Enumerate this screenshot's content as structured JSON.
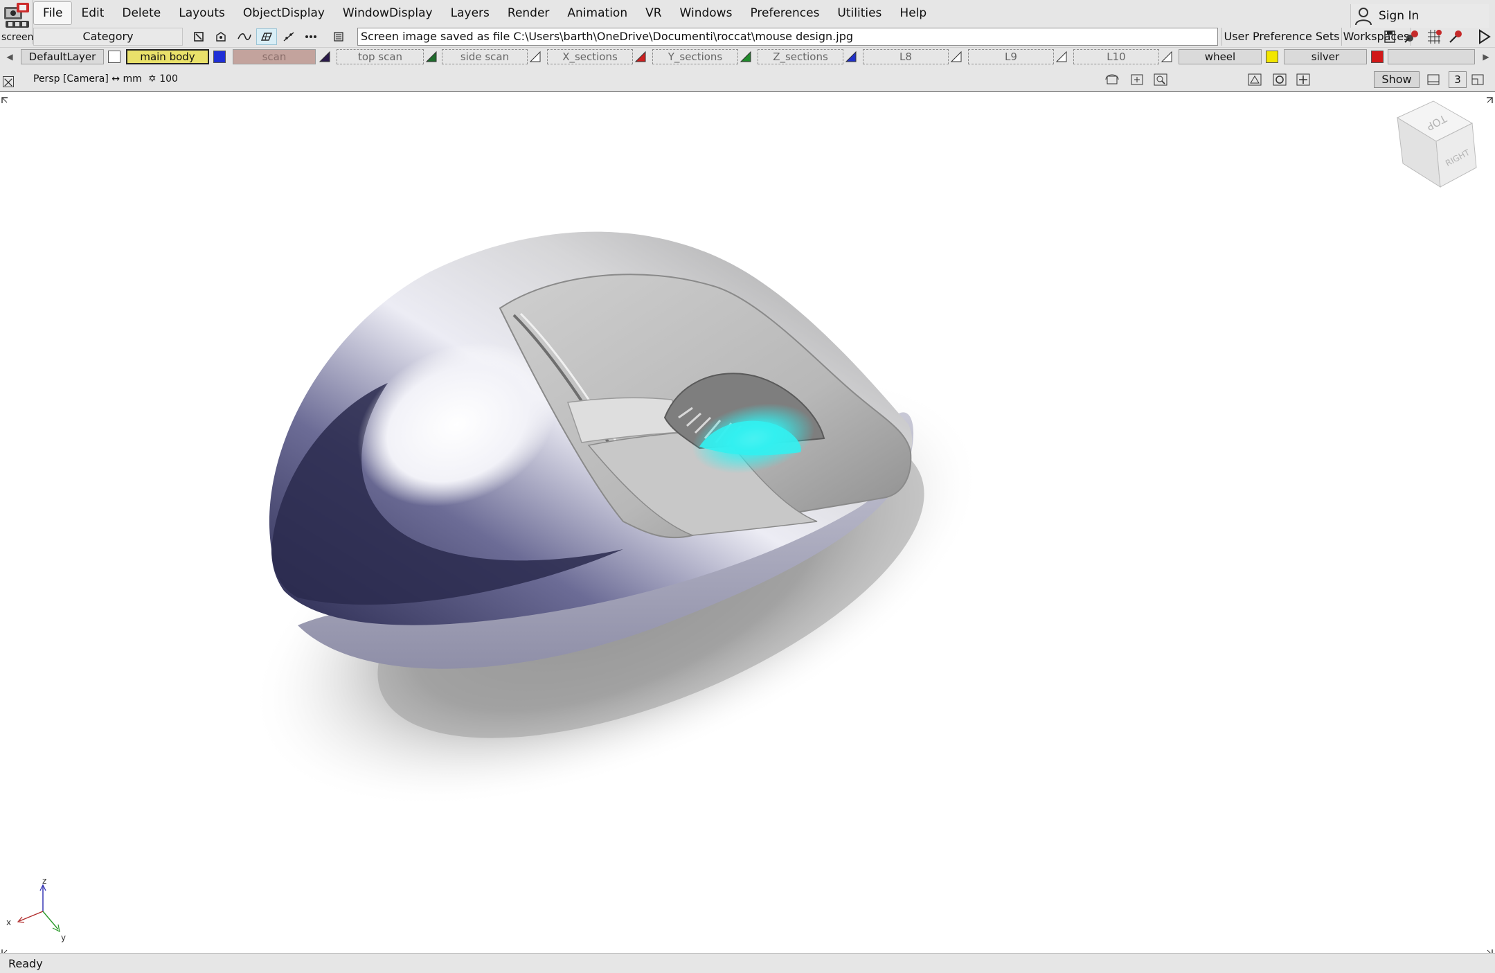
{
  "app": {
    "logo_label": "screen"
  },
  "menu": [
    "File",
    "Edit",
    "Delete",
    "Layouts",
    "ObjectDisplay",
    "WindowDisplay",
    "Layers",
    "Render",
    "Animation",
    "VR",
    "Windows",
    "Preferences",
    "Utilities",
    "Help"
  ],
  "account": {
    "sign_in": "Sign In"
  },
  "toolbar": {
    "category": "Category",
    "prompt": "Screen image saved as file C:\\Users\\barth\\OneDrive\\Documenti\\roccat\\mouse design.jpg",
    "user_preference_sets": "User Preference Sets",
    "workspaces": "Workspaces"
  },
  "layers": {
    "default": "DefaultLayer",
    "main_body": "main body",
    "scan": "scan",
    "top_scan": "top scan",
    "side_scan": "side scan",
    "x_sections": "X_sections",
    "y_sections": "Y_sections",
    "z_sections": "Z_sections",
    "l8": "L8",
    "l9": "L9",
    "l10": "L10",
    "wheel": "wheel",
    "silver": "silver",
    "colors": {
      "main_body": "#1f2fd6",
      "top_scan": "#1e6b2b",
      "x_sections": "#cc1f1f",
      "y_sections": "#1f8a2a",
      "z_sections": "#2030c8",
      "scan": "#2a1a4a",
      "wheel": "#f2e600",
      "silver": "#d11818"
    }
  },
  "view": {
    "camera": "Persp [Camera]",
    "units": "mm",
    "grid": "100",
    "show": "Show",
    "windows_count": "3"
  },
  "view_cube": {
    "top": "TOP",
    "right": "RIGHT"
  },
  "axes": {
    "x": "x",
    "y": "y",
    "z": "z"
  },
  "status": {
    "text": "Ready"
  }
}
